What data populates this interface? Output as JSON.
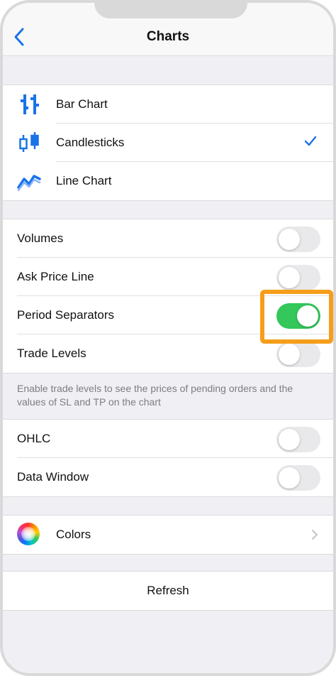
{
  "header": {
    "title": "Charts",
    "back_icon": "chevron-left-icon"
  },
  "chart_types": [
    {
      "label": "Bar Chart",
      "icon": "bar-chart-icon",
      "selected": false
    },
    {
      "label": "Candlesticks",
      "icon": "candlestick-icon",
      "selected": true
    },
    {
      "label": "Line Chart",
      "icon": "line-chart-icon",
      "selected": false
    }
  ],
  "settings": [
    {
      "label": "Volumes",
      "on": false
    },
    {
      "label": "Ask Price Line",
      "on": false
    },
    {
      "label": "Period Separators",
      "on": true
    },
    {
      "label": "Trade Levels",
      "on": false
    }
  ],
  "settings_note": "Enable trade levels to see the prices of pending orders and the values of SL and TP on the chart",
  "extras": [
    {
      "label": "OHLC",
      "on": false
    },
    {
      "label": "Data Window",
      "on": false
    }
  ],
  "colors": {
    "label": "Colors",
    "icon": "color-wheel-icon"
  },
  "refresh": {
    "label": "Refresh"
  },
  "theme": {
    "accent": "#1a73e8",
    "toggle_on": "#34c759",
    "highlight": "#f59e1b"
  }
}
